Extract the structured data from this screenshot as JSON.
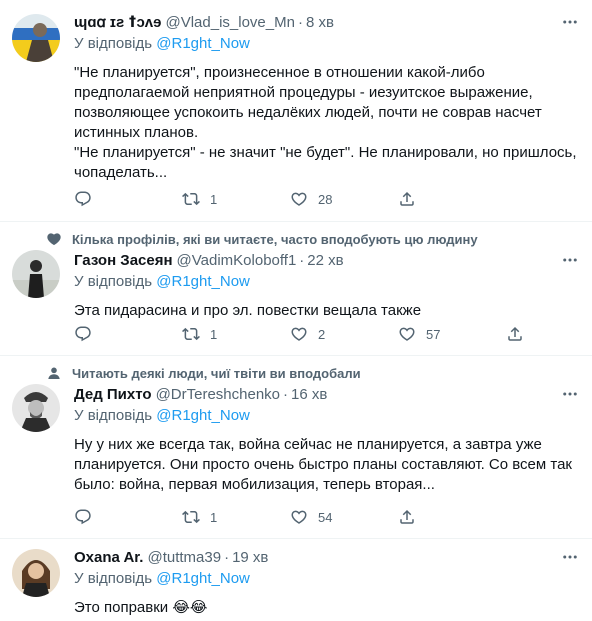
{
  "tweets": [
    {
      "social_context": "",
      "name": "ɰɑꭤ ɪƨ ꝉɔʌɘ",
      "handle": "@Vlad_is_love_Mn",
      "time": "8 хв",
      "reply_prefix": "У відповідь",
      "reply_to": "@R1ght_Now",
      "text": "\"Не планируется\", произнесенное в отношении какой-либо предполагаемой неприятной процедуры - иезуитское выражение, позволяющее успокоить недалёких людей, почти не соврав насчет истинных планов.\n\"Не планируется\" - не значит \"не будет\". Не планировали, но пришлось, чопаделать...",
      "replies": "",
      "retweets": "1",
      "likes": "28"
    },
    {
      "social_context": "Кілька профілів, які ви читаєте, часто вподобують цю людину",
      "name": "Газон Засеян",
      "handle": "@VadimKoloboff1",
      "time": "22 хв",
      "reply_prefix": "У відповідь",
      "reply_to": "@R1ght_Now",
      "text": "Эта пидарасина и про эл. повестки вещала также",
      "replies": "",
      "retweets": "1",
      "likes": "57",
      "extra_count": "2"
    },
    {
      "social_context": "Читають деякі люди, чиї твіти ви вподобали",
      "name": "Дед Пихто",
      "handle": "@DrTereshchenko",
      "time": "16 хв",
      "reply_prefix": "У відповідь",
      "reply_to": "@R1ght_Now",
      "text": "Ну у них же всегда так, война сейчас не планируется, а завтра уже планируется. Они просто очень быстро планы составляют. Со всем так было: война, первая мобилизация, теперь вторая...",
      "replies": "",
      "retweets": "1",
      "likes": "54"
    },
    {
      "social_context": "",
      "name": "Oxana Ar.",
      "handle": "@tuttma39",
      "time": "19 хв",
      "reply_prefix": "У відповідь",
      "reply_to": "@R1ght_Now",
      "text": "Это поправки 😂😂"
    }
  ],
  "separator": "·",
  "icons": {
    "more": "more-horizontal-icon",
    "reply": "reply-bubble-icon",
    "retweet": "retweet-icon",
    "like": "heart-icon",
    "share": "share-icon",
    "social_like": "heart-icon",
    "social_follow": "person-icon"
  },
  "colors": {
    "text": "#0f1419",
    "secondary": "#536471",
    "accent": "#1d9bf0",
    "divider": "#eff3f4"
  }
}
